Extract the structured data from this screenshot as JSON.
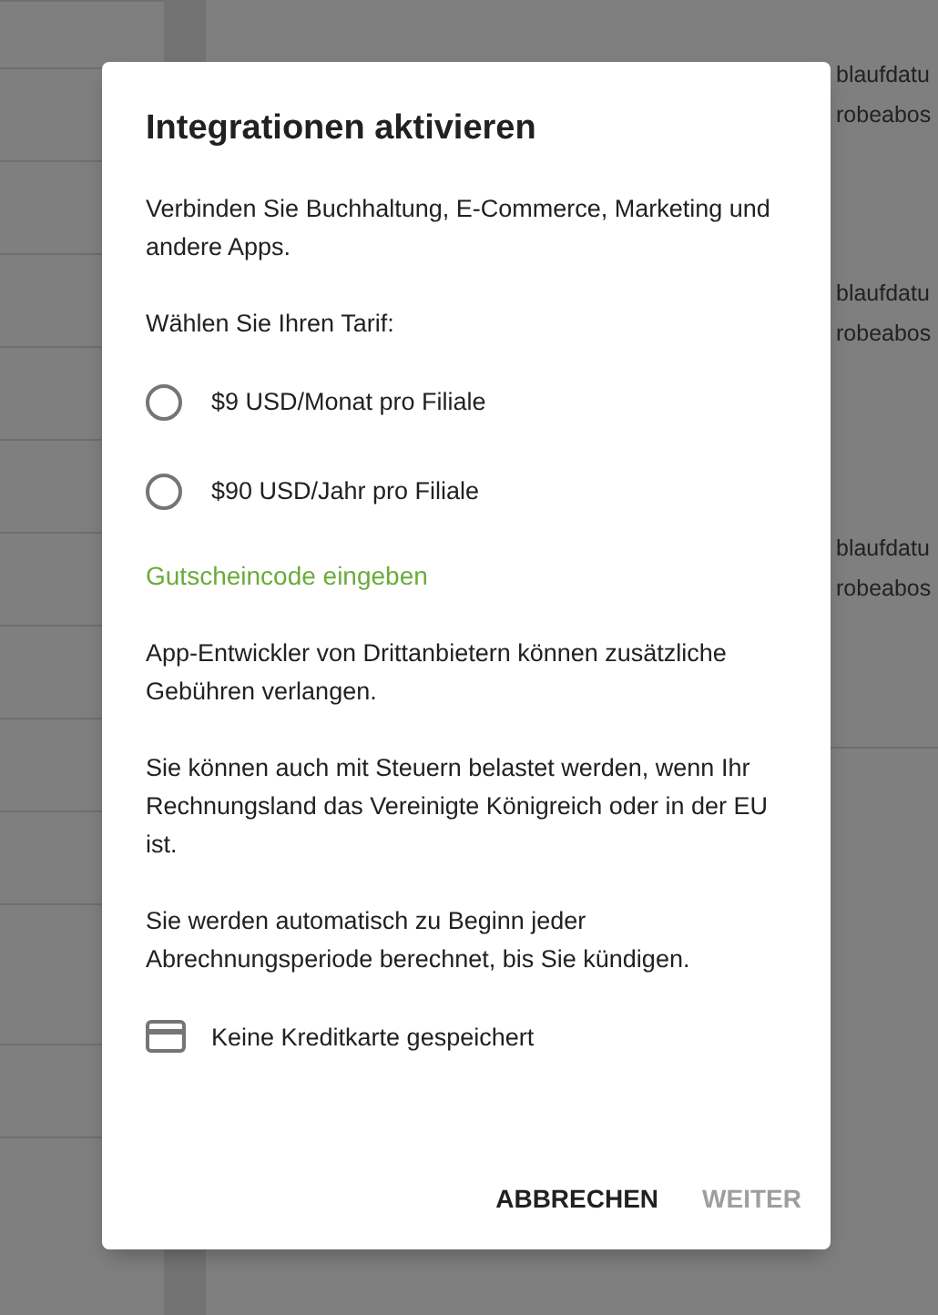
{
  "background": {
    "cards": [
      {
        "lines": [
          "blaufdatu",
          "robeabos"
        ]
      },
      {
        "lines": [
          "blaufdatu",
          "robeabos"
        ]
      },
      {
        "lines": [
          "blaufdatu",
          "robeabos"
        ]
      }
    ]
  },
  "dialog": {
    "title": "Integrationen aktivieren",
    "intro": "Verbinden Sie Buchhaltung, E-Commerce, Marketing und andere Apps.",
    "tariff_label": "Wählen Sie Ihren Tarif:",
    "options": [
      {
        "label": "$9 USD/Monat pro Filiale",
        "selected": false
      },
      {
        "label": "$90 USD/Jahr pro Filiale",
        "selected": false
      }
    ],
    "coupon_link": "Gutscheincode eingeben",
    "notes": [
      "App-Entwickler von Drittanbietern können zusätzliche Gebühren verlangen.",
      "Sie können auch mit Steuern belastet werden, wenn Ihr Rechnungsland das Vereinigte Königreich oder in der EU ist.",
      "Sie werden automatisch zu Beginn jeder Abrechnungsperiode berechnet, bis Sie kündigen."
    ],
    "payment": {
      "text": "Keine Kreditkarte gespeichert"
    },
    "buttons": [
      {
        "label": "ABBRECHEN",
        "disabled": false
      },
      {
        "label": "WEITER",
        "disabled": true
      }
    ]
  }
}
